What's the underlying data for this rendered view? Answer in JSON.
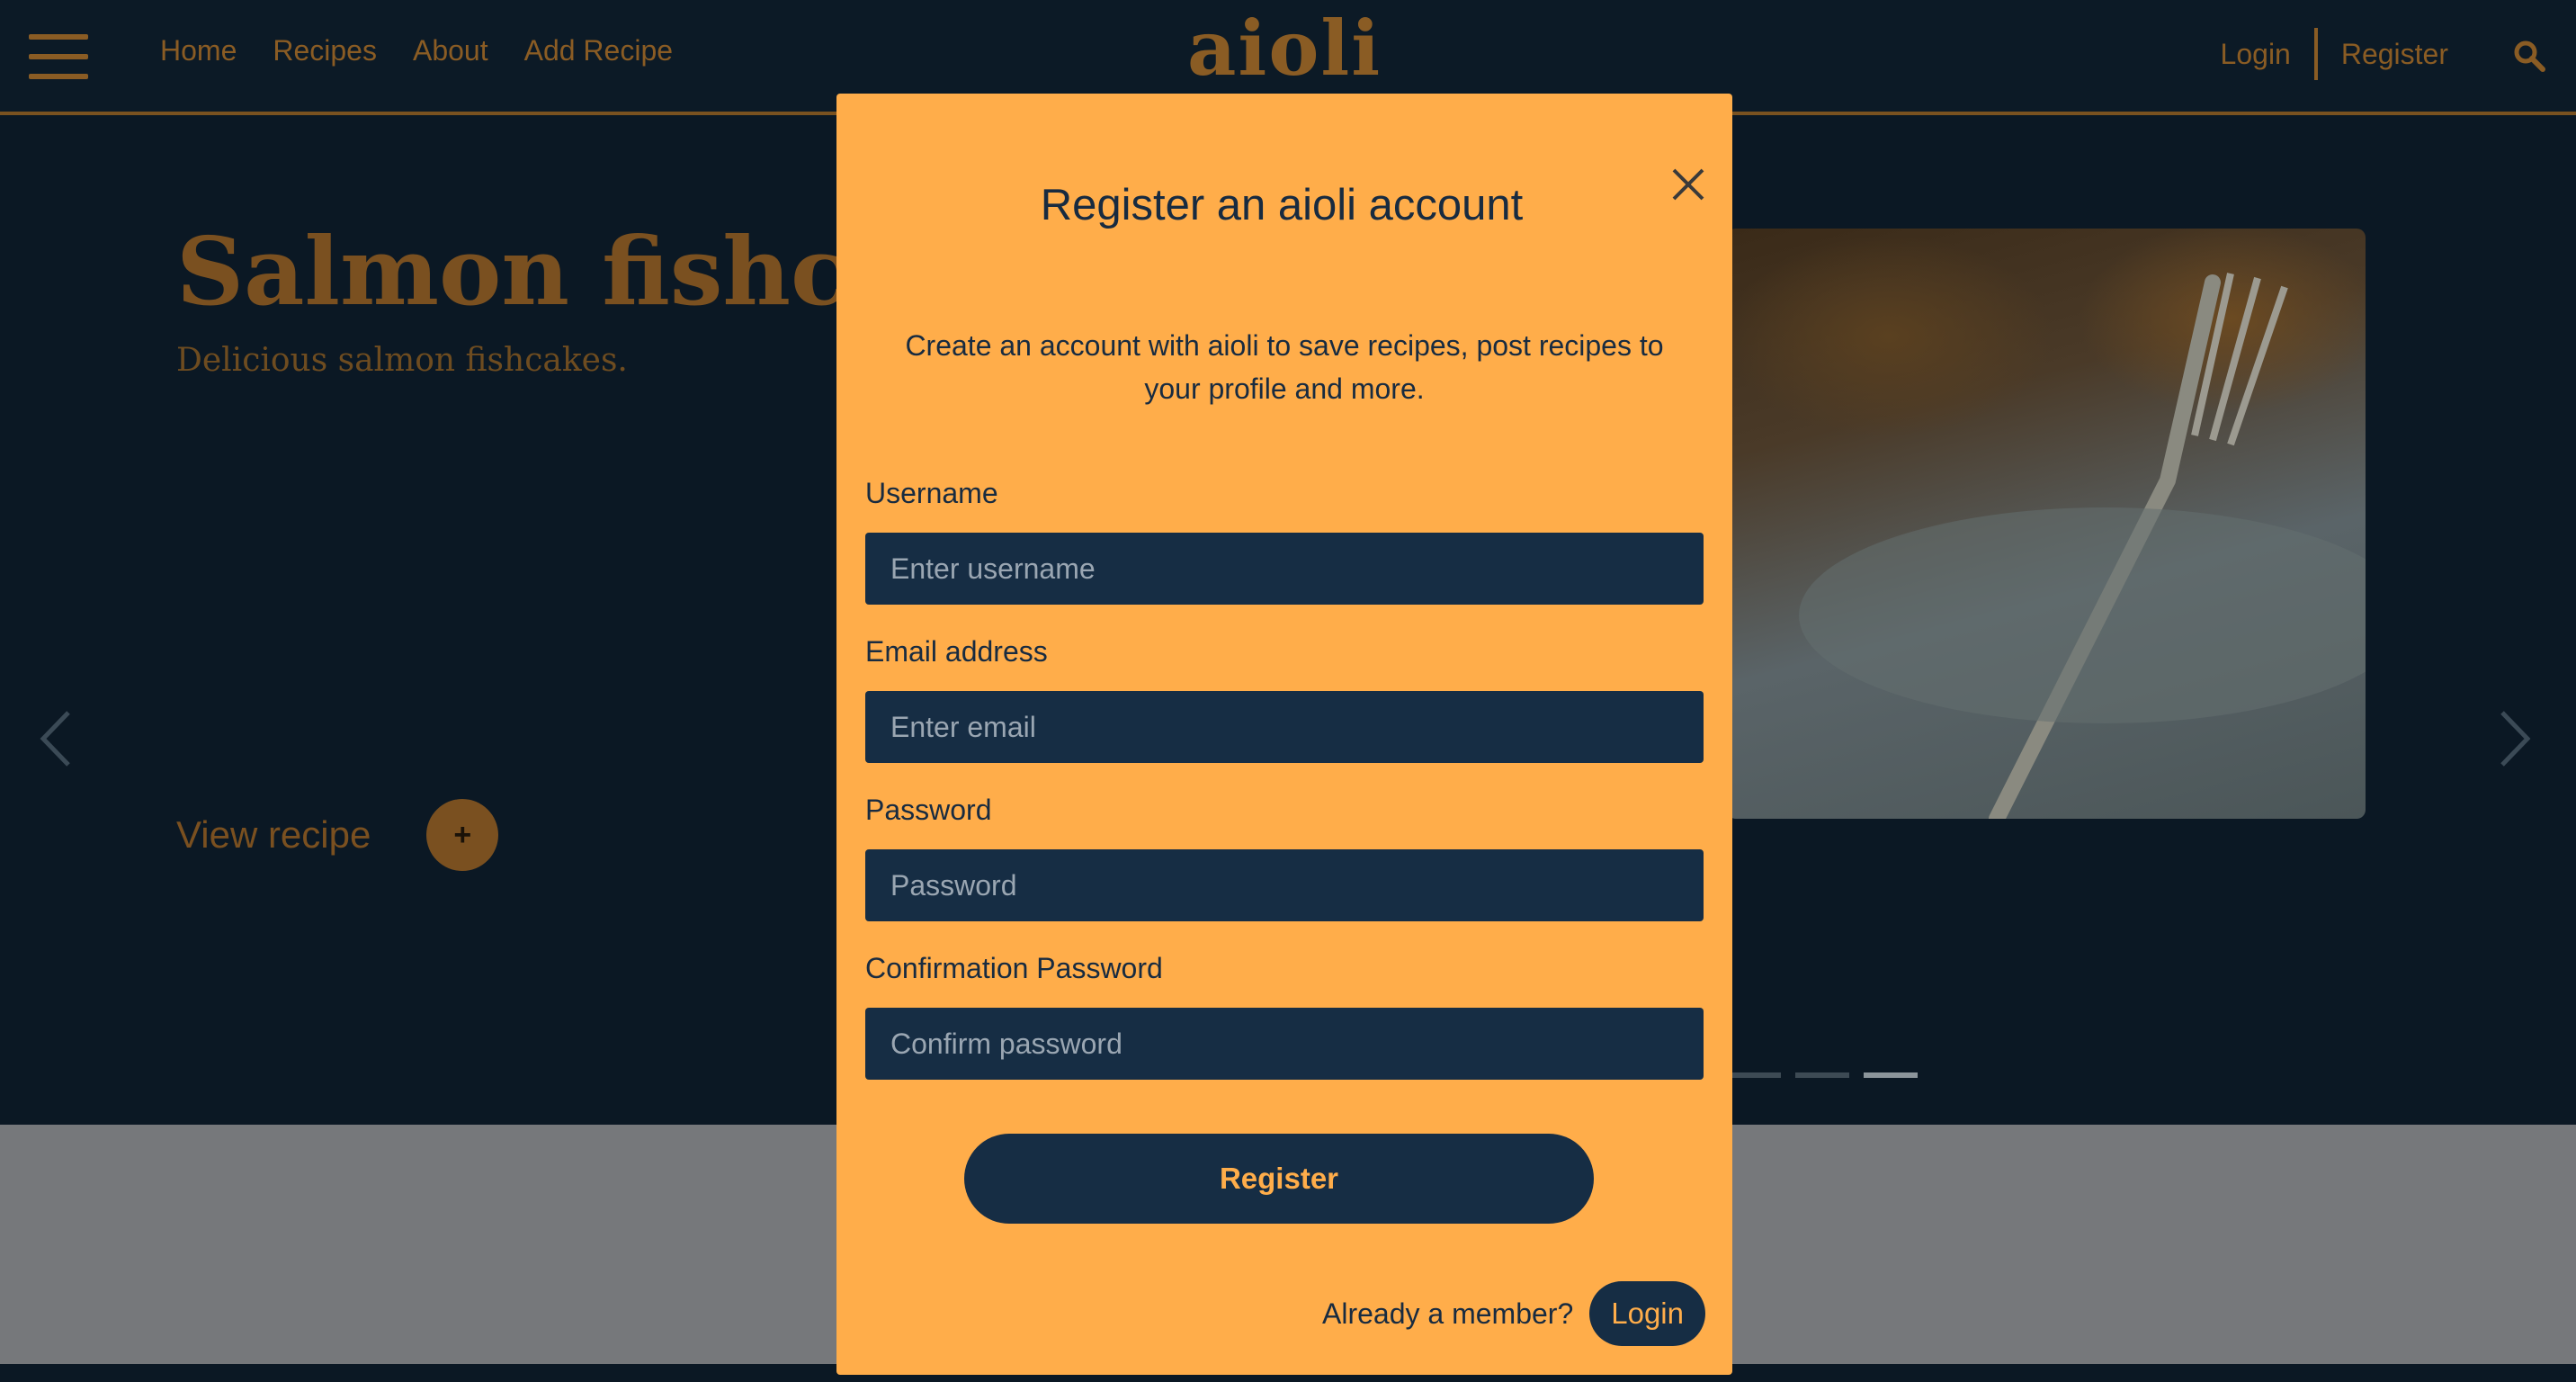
{
  "navbar": {
    "links": [
      "Home",
      "Recipes",
      "About",
      "Add Recipe"
    ],
    "brand": "aioli",
    "login": "Login",
    "register": "Register",
    "menu_icon": "hamburger-menu-icon",
    "search_icon": "search-icon"
  },
  "hero": {
    "title": "Salmon fishcakes",
    "subtitle": "Delicious salmon fishcakes.",
    "view_recipe": "View recipe",
    "plus": "+",
    "prev_icon": "chevron-left-icon",
    "next_icon": "chevron-right-icon",
    "active_slide": 3,
    "visible_indicators": 3
  },
  "modal": {
    "title": "Register an aioli account",
    "description": "Create an account with aioli to save recipes, post recipes to your profile and more.",
    "fields": {
      "username": {
        "label": "Username",
        "placeholder": "Enter username",
        "value": ""
      },
      "email": {
        "label": "Email address",
        "placeholder": "Enter email",
        "value": ""
      },
      "password": {
        "label": "Password",
        "placeholder": "Password",
        "value": ""
      },
      "confirm": {
        "label": "Confirmation Password",
        "placeholder": "Confirm password",
        "value": ""
      }
    },
    "register_button": "Register",
    "already_member": "Already a member?",
    "login_button": "Login",
    "close_icon": "close-icon"
  },
  "colors": {
    "page_bg": "#0b1824",
    "brand_dim": "#8a5c24",
    "modal_bg": "#ffad4a",
    "input_bg": "#162d44",
    "text_dark": "#182b40",
    "overlay_band": "#76787b"
  }
}
